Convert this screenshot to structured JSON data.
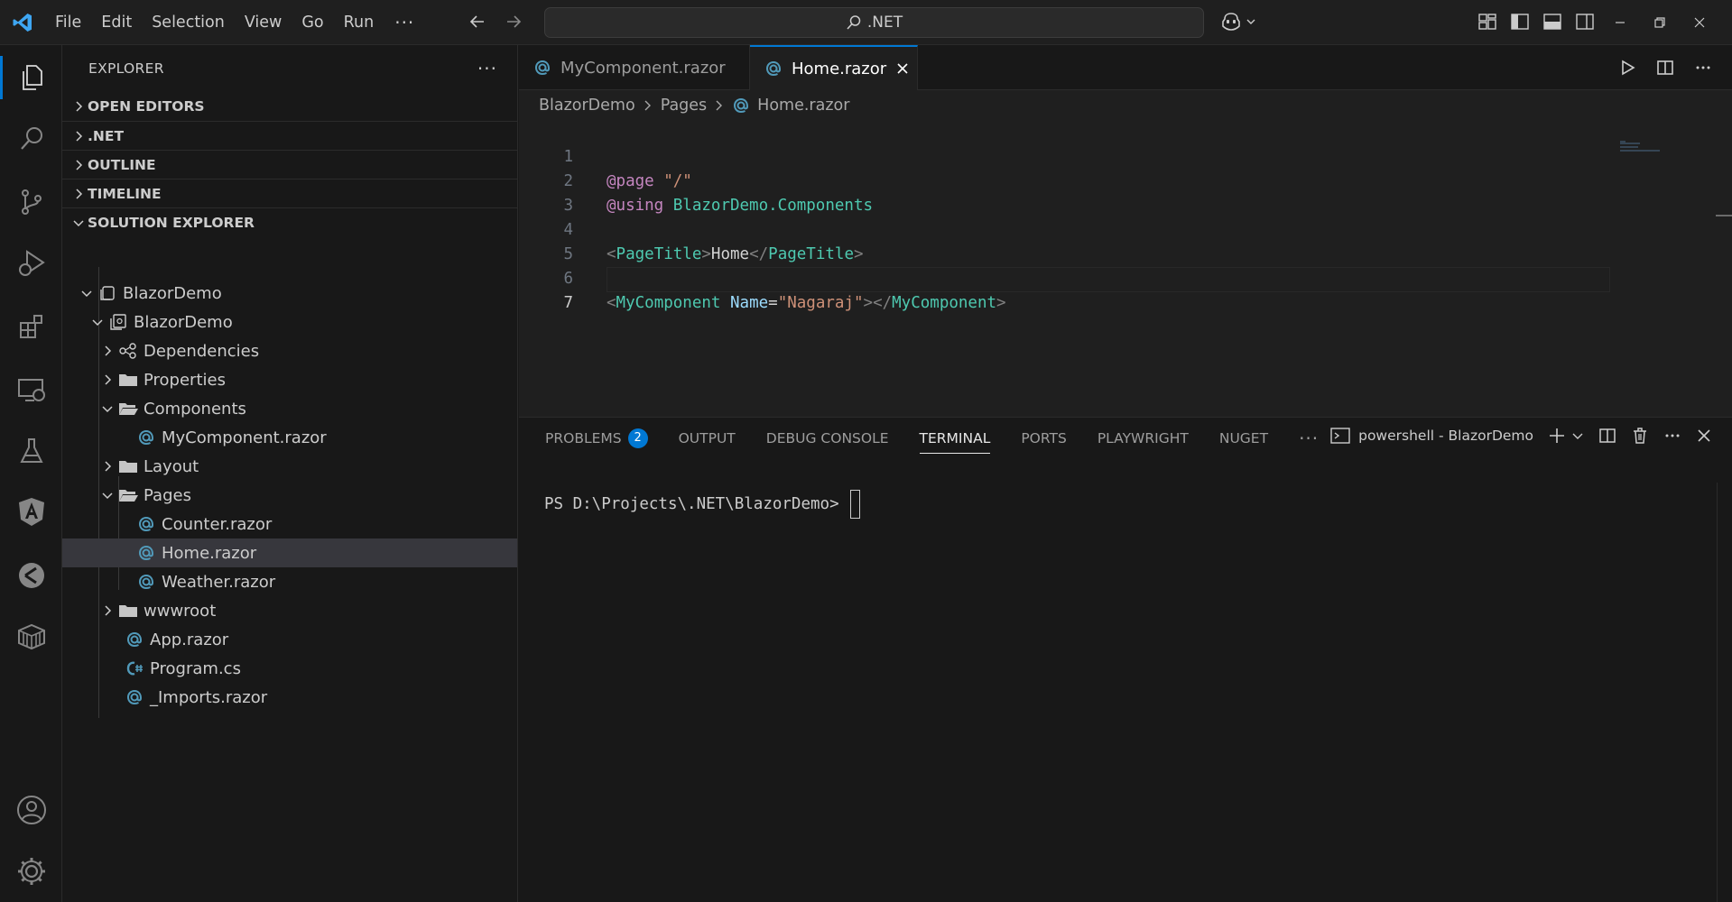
{
  "titlebar": {
    "menu": [
      "File",
      "Edit",
      "Selection",
      "View",
      "Go",
      "Run"
    ],
    "more": "···",
    "search_text": ".NET",
    "icons": [
      "vscode-logo-icon",
      "back-icon",
      "forward-icon",
      "search-icon",
      "copilot-icon",
      "customize-layout-icon",
      "toggle-sidebar-icon",
      "toggle-panel-icon",
      "toggle-secondary-sidebar-icon",
      "minimize-icon",
      "restore-icon",
      "close-icon"
    ]
  },
  "activitybar": {
    "items": [
      "explorer-icon",
      "search-icon",
      "source-control-icon",
      "run-debug-icon",
      "extensions-icon",
      "remote-explorer-icon",
      "testing-icon",
      "angular-icon",
      "git-lens-icon",
      "containers-icon",
      "accounts-icon",
      "settings-gear-icon"
    ]
  },
  "sidebar": {
    "title": "EXPLORER",
    "more": "···",
    "sections": {
      "open_editors": "OPEN EDITORS",
      "dotnet": ".NET",
      "outline": "OUTLINE",
      "timeline": "TIMELINE",
      "solution_explorer": "SOLUTION EXPLORER"
    },
    "tree": {
      "solution": "BlazorDemo",
      "project": "BlazorDemo",
      "dependencies": "Dependencies",
      "properties": "Properties",
      "components": "Components",
      "my_component": "MyComponent.razor",
      "layout": "Layout",
      "pages": "Pages",
      "counter": "Counter.razor",
      "home": "Home.razor",
      "weather": "Weather.razor",
      "wwwroot": "wwwroot",
      "app": "App.razor",
      "program": "Program.cs",
      "imports": "_Imports.razor"
    }
  },
  "editor": {
    "tabs": [
      {
        "label": "MyComponent.razor",
        "active": false
      },
      {
        "label": "Home.razor",
        "active": true
      }
    ],
    "breadcrumb": [
      "BlazorDemo",
      "Pages",
      "Home.razor"
    ],
    "line_numbers": [
      "1",
      "2",
      "3",
      "4",
      "5",
      "6",
      "7"
    ],
    "code": {
      "l1_dir": "@page",
      "l1_str": "\"/\"",
      "l2_dir": "@using",
      "l2_txt": "BlazorDemo.Components",
      "l4_open_lt": "<",
      "l4_tag": "PageTitle",
      "l4_open_gt": ">",
      "l4_txt": "Home",
      "l4_close_lt": "</",
      "l4_ctag": "PageTitle",
      "l4_close_gt": ">",
      "l6_lt": "<",
      "l6_tag": "MyComponent",
      "l6_attr": "Name",
      "l6_eq": "=",
      "l6_val": "\"Nagaraj\"",
      "l6_mid": "></",
      "l6_ctag": "MyComponent",
      "l6_gt": ">"
    }
  },
  "panel": {
    "tabs": [
      "PROBLEMS",
      "OUTPUT",
      "DEBUG CONSOLE",
      "TERMINAL",
      "PORTS",
      "PLAYWRIGHT",
      "NUGET"
    ],
    "problems_count": "2",
    "active_tab": "TERMINAL",
    "more": "···",
    "terminal_name": "powershell - BlazorDemo",
    "prompt": "PS D:\\Projects\\.NET\\BlazorDemo>"
  },
  "colors": {
    "accent": "#0078d4",
    "editor_bg": "#1f1f1f",
    "sidebar_bg": "#181818",
    "razor_icon": "#519aba",
    "csharp_icon": "#519aba"
  }
}
